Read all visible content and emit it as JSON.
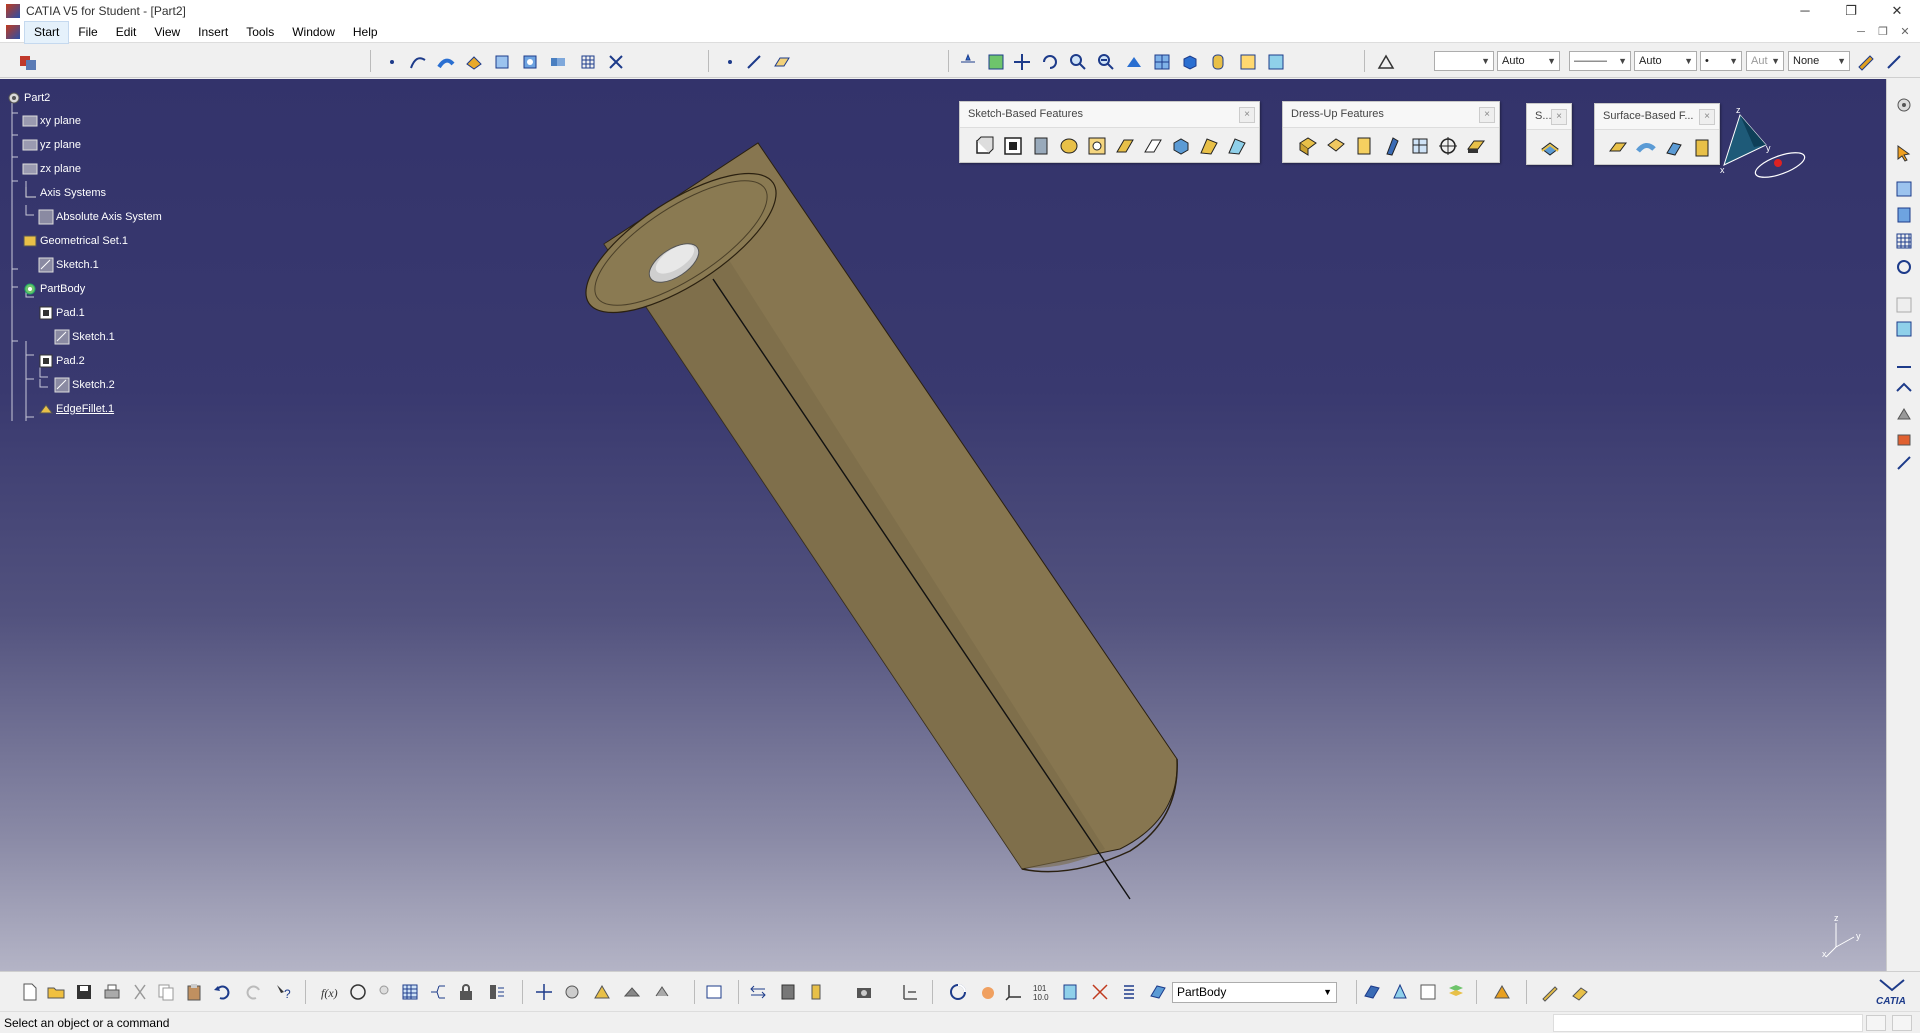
{
  "window": {
    "title": "CATIA V5 for Student - [Part2]",
    "minimize": "─",
    "maximize": "❐",
    "close": "✕"
  },
  "menu": {
    "items": [
      "Start",
      "File",
      "Edit",
      "View",
      "Insert",
      "Tools",
      "Window",
      "Help"
    ]
  },
  "toolbar_top": {
    "line_type": "",
    "line_thickness": "Auto",
    "line_style": "———",
    "weight": "Auto",
    "point_style": "•",
    "layer_trunc": "Aut",
    "render": "None"
  },
  "tree": {
    "root": "Part2",
    "nodes": [
      {
        "label": "xy plane"
      },
      {
        "label": "yz plane"
      },
      {
        "label": "zx plane"
      },
      {
        "label": "Axis Systems"
      },
      {
        "label": "Absolute Axis System"
      },
      {
        "label": "Geometrical Set.1"
      },
      {
        "label": "Sketch.1"
      },
      {
        "label": "PartBody"
      },
      {
        "label": "Pad.1"
      },
      {
        "label": "Sketch.1"
      },
      {
        "label": "Pad.2"
      },
      {
        "label": "Sketch.2"
      },
      {
        "label": "EdgeFillet.1"
      }
    ]
  },
  "floating_toolbars": {
    "sketch_based": "Sketch-Based Features",
    "dress_up": "Dress-Up Features",
    "s_trunc": "S...",
    "surface_based": "Surface-Based F...",
    "close": "×"
  },
  "compass": {
    "x": "x",
    "y": "y",
    "z": "z"
  },
  "axis_triad": {
    "x": "x",
    "y": "y",
    "z": "z"
  },
  "bottom_toolbar": {
    "current_body": "PartBody",
    "brand": "CATIA"
  },
  "status": {
    "message": "Select an object or a command"
  },
  "colors": {
    "viewport_top": "#33336b",
    "viewport_bottom": "#b4b4c6",
    "part_color": "#8b7a4f"
  }
}
